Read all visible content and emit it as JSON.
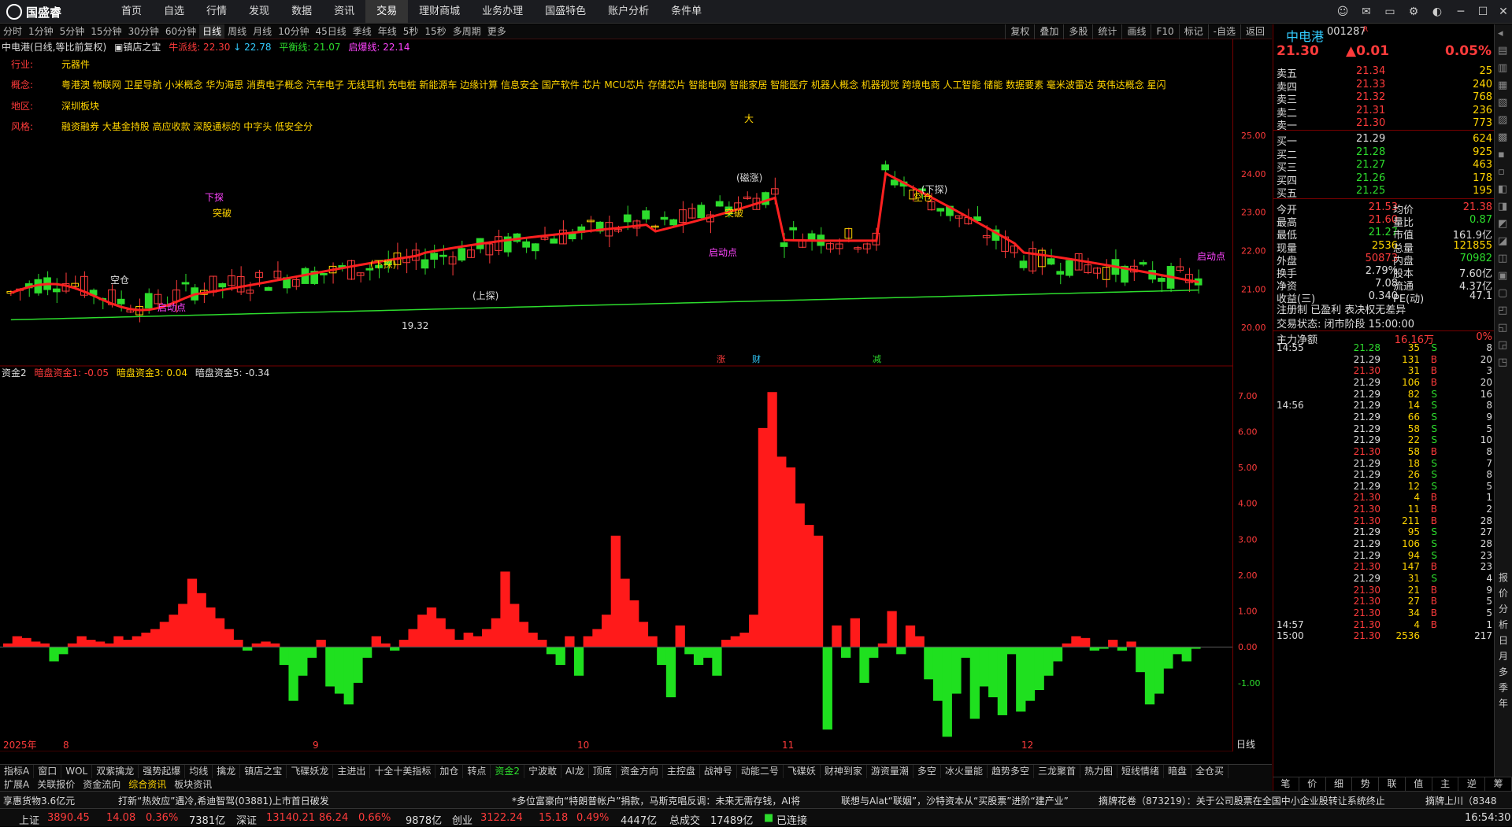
{
  "app": {
    "brand": "国盛睿",
    "menu": [
      "首页",
      "自选",
      "行情",
      "发现",
      "数据",
      "资讯",
      "交易",
      "理财商城",
      "业务办理",
      "国盛特色",
      "账户分析",
      "条件单"
    ],
    "active": "交易"
  },
  "periods": [
    "分时",
    "1分钟",
    "5分钟",
    "15分钟",
    "30分钟",
    "60分钟",
    "日线",
    "周线",
    "月线",
    "10分钟",
    "45日线",
    "季线",
    "年线",
    "5秒",
    "15秒",
    "多周期",
    "更多"
  ],
  "period_selected": "日线",
  "chart_tools": [
    "复权",
    "叠加",
    "多股",
    "统计",
    "画线",
    "F10",
    "标记",
    "-自选",
    "返回"
  ],
  "title_line": {
    "name": "中电港(日线,等比前复权)",
    "indicator": "镇店之宝",
    "bull": "牛派线: 22.30",
    "mid": "↓ 22.78",
    "bal": "平衡线: 21.07",
    "start": "启爆线: 22.14"
  },
  "info": {
    "industry_label": "行业:",
    "industry": "元器件",
    "concept_label": "概念:",
    "concepts": "粤港澳 物联网 卫星导航 小米概念 华为海思 消费电子概念 汽车电子 无线耳机 充电桩 新能源车 边缘计算 信息安全 国产软件 芯片 MCU芯片 存储芯片 智能电网 智能家居 智能医疗 机器人概念 机器视觉 跨境电商 人工智能 储能 数据要素 毫米波雷达 英伟达概念 星闪",
    "region_label": "地区:",
    "region": "深圳板块",
    "style_label": "风格:",
    "style": "融资融券 大基金持股 高应收款 深股通标的 中字头 低安全分"
  },
  "chart_data": {
    "type": "candlestick",
    "ylim": [
      19.0,
      27.5
    ],
    "yticks": [
      "25.00",
      "24.00",
      "23.00",
      "22.00",
      "21.00",
      "20.00"
    ],
    "x_labels": [
      "2025年",
      "8",
      "9",
      "10",
      "11",
      "12"
    ],
    "low_label": "19.32",
    "annotations": [
      "突破",
      "下探",
      "空仓",
      "(下探)",
      "启动点",
      "(上探)",
      "突破",
      "启动点",
      "(下探)",
      "空仓",
      "启动点",
      "(磁涨)",
      "大"
    ],
    "markers": [
      "涨",
      "财",
      "减"
    ],
    "indicator": {
      "name": "资金2",
      "s1": "暗盘资金1: -0.05",
      "s3": "暗盘资金3: 0.04",
      "s5": "暗盘资金5: -0.34",
      "yticks": [
        "7.00",
        "6.00",
        "5.00",
        "4.00",
        "3.00",
        "2.00",
        "1.00",
        "0.00",
        "-1.00"
      ],
      "values": [
        0.1,
        0.3,
        0.25,
        0.15,
        0.1,
        -0.4,
        -0.2,
        0.1,
        0.3,
        0.2,
        0.15,
        0.1,
        0.3,
        0.2,
        0.3,
        0.4,
        0.5,
        0.7,
        0.9,
        1.2,
        1.9,
        1.5,
        1.1,
        0.8,
        0.5,
        0.2,
        -0.1,
        0.1,
        0.15,
        0.1,
        -0.5,
        -1.5,
        -0.8,
        -0.3,
        0.2,
        -1.1,
        -1.3,
        -1.6,
        -1.0,
        -0.3,
        0.3,
        0.1,
        -0.1,
        0.2,
        0.5,
        0.9,
        1.1,
        0.8,
        0.5,
        0.2,
        0.4,
        0.3,
        0.5,
        0.8,
        2.1,
        1.2,
        0.7,
        0.4,
        0.2,
        -0.2,
        -0.5,
        0.3,
        -0.8,
        0.3,
        0.5,
        0.9,
        3.1,
        1.9,
        1.3,
        0.7,
        0.3,
        -0.5,
        -1.4,
        0.6,
        -0.2,
        -0.5,
        -0.3,
        -0.8,
        0.2,
        0.3,
        0.4,
        0.9,
        6.1,
        7.1,
        5.3,
        5.0,
        4.0,
        3.4,
        3.1,
        -2.3,
        0.6,
        -0.3,
        0.8,
        -1.0,
        -0.3,
        0.1,
        1.0,
        -0.2,
        0.6,
        0.3,
        -0.9,
        -1.5,
        -2.5,
        -1.3,
        -0.3,
        -2.0,
        -1.1,
        -1.4,
        -1.9,
        -0.2,
        -1.8,
        -1.5,
        -1.2,
        -0.8,
        -0.4,
        0.1,
        0.3,
        0.25,
        -0.1,
        -0.05,
        0.2,
        -0.1,
        0.15,
        -0.7,
        -1.6,
        -1.3,
        -0.6,
        -0.2,
        -0.4,
        -0.05
      ]
    }
  },
  "quote": {
    "name": "中电港",
    "code": "001287",
    "rlabel": "R",
    "price": "21.30",
    "change": "▲0.01",
    "pct": "0.05%",
    "asks": [
      {
        "l": "卖五",
        "p": "21.34",
        "v": "25"
      },
      {
        "l": "卖四",
        "p": "21.33",
        "v": "240"
      },
      {
        "l": "卖三",
        "p": "21.32",
        "v": "768"
      },
      {
        "l": "卖二",
        "p": "21.31",
        "v": "236"
      },
      {
        "l": "卖一",
        "p": "21.30",
        "v": "773"
      }
    ],
    "bids": [
      {
        "l": "买一",
        "p": "21.29",
        "v": "624"
      },
      {
        "l": "买二",
        "p": "21.28",
        "v": "925"
      },
      {
        "l": "买三",
        "p": "21.27",
        "v": "463"
      },
      {
        "l": "买四",
        "p": "21.26",
        "v": "178"
      },
      {
        "l": "买五",
        "p": "21.25",
        "v": "195"
      }
    ],
    "stats": [
      [
        "今开",
        "21.53",
        "均价",
        "21.38"
      ],
      [
        "最高",
        "21.60",
        "量比",
        "0.87"
      ],
      [
        "最低",
        "21.27",
        "市值",
        "161.9亿"
      ],
      [
        "现量",
        "2536",
        "总量",
        "121855"
      ],
      [
        "外盘",
        "50873",
        "内盘",
        "70982"
      ],
      [
        "换手",
        "2.79%",
        "股本",
        "7.60亿"
      ],
      [
        "净资",
        "7.08",
        "流通",
        "4.37亿"
      ],
      [
        "收益(三)",
        "0.340",
        "PE(动)",
        "47.1"
      ]
    ],
    "tags": "注册制 已盈利 表决权无差异",
    "trade_status": "交易状态: 闭市阶段 15:00:00",
    "net_label": "主力净额",
    "net": "16.16万",
    "net_pct": "0%",
    "mini": [
      "21.30",
      "773",
      "21.29",
      "624",
      "21.30",
      "▲0.01",
      "0.05%",
      "2536"
    ],
    "ticks": [
      [
        "14:55",
        "21.28",
        "35",
        "S",
        "8"
      ],
      [
        "",
        "21.29",
        "131",
        "B",
        "20"
      ],
      [
        "",
        "21.30",
        "31",
        "B",
        "3"
      ],
      [
        "",
        "21.29",
        "106",
        "B",
        "20"
      ],
      [
        "",
        "21.29",
        "82",
        "S",
        "16"
      ],
      [
        "14:56",
        "21.29",
        "14",
        "S",
        "8"
      ],
      [
        "",
        "21.29",
        "66",
        "S",
        "9"
      ],
      [
        "",
        "21.29",
        "58",
        "S",
        "5"
      ],
      [
        "",
        "21.29",
        "22",
        "S",
        "10"
      ],
      [
        "",
        "21.30",
        "58",
        "B",
        "8"
      ],
      [
        "",
        "21.29",
        "18",
        "S",
        "7"
      ],
      [
        "",
        "21.29",
        "26",
        "S",
        "8"
      ],
      [
        "",
        "21.29",
        "12",
        "S",
        "5"
      ],
      [
        "",
        "21.30",
        "4",
        "B",
        "1"
      ],
      [
        "",
        "21.30",
        "11",
        "B",
        "2"
      ],
      [
        "",
        "21.30",
        "211",
        "B",
        "28"
      ],
      [
        "",
        "21.29",
        "95",
        "S",
        "27"
      ],
      [
        "",
        "21.29",
        "106",
        "S",
        "28"
      ],
      [
        "",
        "21.29",
        "94",
        "S",
        "23"
      ],
      [
        "",
        "21.30",
        "147",
        "B",
        "23"
      ],
      [
        "",
        "21.29",
        "31",
        "S",
        "4"
      ],
      [
        "",
        "21.30",
        "21",
        "B",
        "9"
      ],
      [
        "",
        "21.30",
        "27",
        "B",
        "5"
      ],
      [
        "",
        "21.30",
        "34",
        "B",
        "5"
      ],
      [
        "14:57",
        "21.30",
        "4",
        "B",
        "1"
      ],
      [
        "15:00",
        "21.30",
        "2536",
        "",
        "217"
      ]
    ],
    "tabs": [
      "笔",
      "价",
      "细",
      "势",
      "联",
      "值",
      "主",
      "逆",
      "筹"
    ]
  },
  "sidebar": [
    "报",
    "价",
    "分",
    "析",
    "日",
    "月",
    "多",
    "季",
    "年"
  ],
  "indicator_tabs": [
    "指标A",
    "窗口",
    "WOL",
    "双紫擒龙",
    "强势起爆",
    "均线",
    "擒龙",
    "镇店之宝",
    "飞碟妖龙",
    "主进出",
    "十全十美指标",
    "加仓",
    "转点",
    "资金2",
    "宁波敢",
    "AI龙",
    "顶底",
    "资金方向",
    "主控盘",
    "战神号",
    "动能二号",
    "飞碟妖",
    "财神到家",
    "游资量潮",
    "多空",
    "冰火量能",
    "趋势多空",
    "三龙聚首",
    "热力图",
    "短线情绪",
    "暗盘",
    "全仓买"
  ],
  "indicator_sel": "资金2",
  "news_tabs": [
    "扩展A",
    "关联报价",
    "资金流向",
    "综合资讯",
    "板块资讯"
  ],
  "news": [
    "享惠货物3.6亿元",
    "打新“热效应”遇冷,希迪智驾(03881)上市首日破发",
    "*多位富豪向“特朗普帐户”捐款，马斯克唱反调：未来无需存钱，AI将",
    "联想与Alat“联姻”，沙特资本从“买股票”进阶“建产业”",
    "摘牌花卷（873219）：关于公司股票在全国中小企业股转让系统终止",
    "摘牌上川（8348"
  ],
  "status": {
    "sh": "上证",
    "sh_v": "3890.45",
    "sh_c": "14.08",
    "sh_p": "0.36%",
    "sh_a": "7381亿",
    "sz": "深证",
    "sz_v": "13140.21",
    "sz_c": "86.24",
    "sz_p": "0.66%",
    "sz_a": "9878亿",
    "cy": "创业",
    "cy_v": "3122.24",
    "cy_c": "15.18",
    "cy_p": "0.49%",
    "cy_a": "4447亿",
    "tot": "总成交",
    "tot_v": "17489亿",
    "conn": "已连接",
    "time": "16:54:30"
  },
  "rightaxis_mode": "日线"
}
